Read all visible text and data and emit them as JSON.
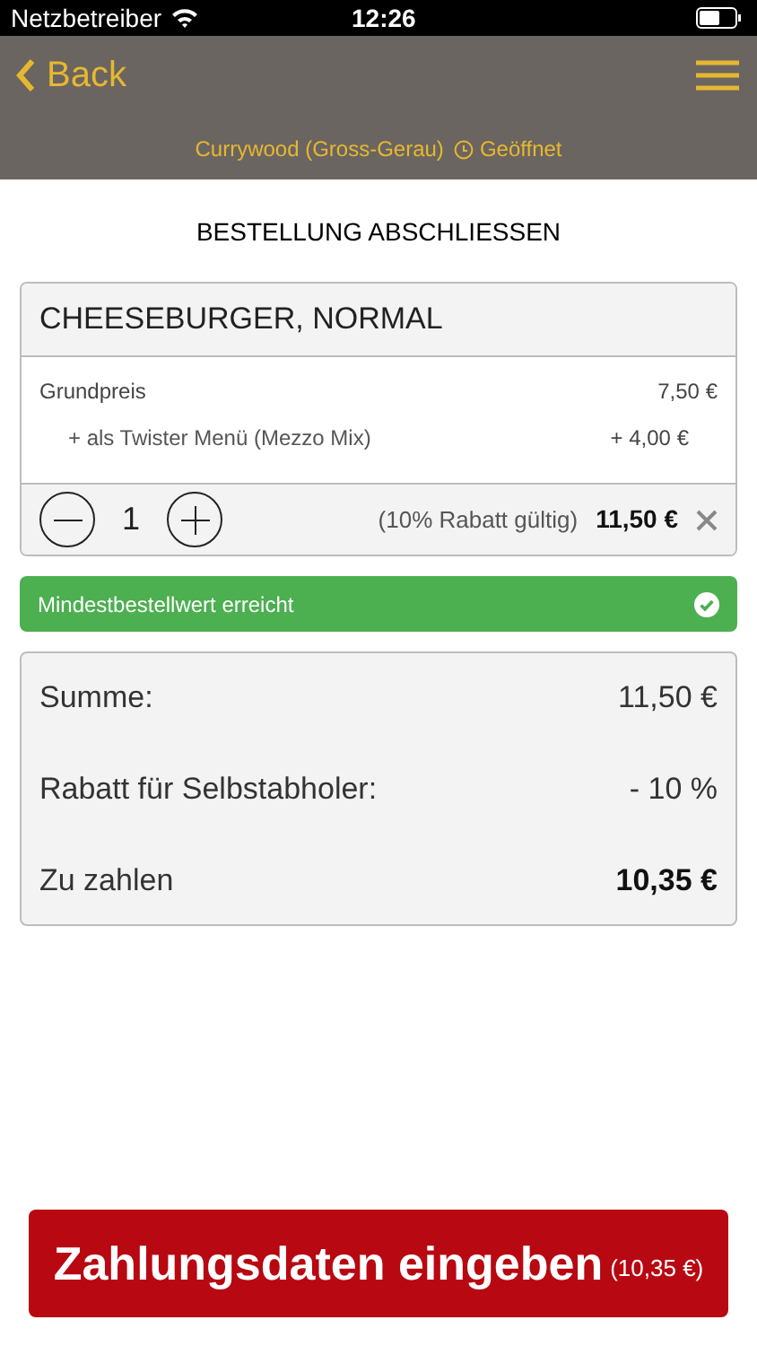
{
  "status_bar": {
    "carrier": "Netzbetreiber",
    "time": "12:26"
  },
  "nav": {
    "back": "Back",
    "restaurant": "Currywood (Gross-Gerau)",
    "status": "Geöffnet"
  },
  "title": "BESTELLUNG ABSCHLIESSEN",
  "item": {
    "name": "CHEESEBURGER, NORMAL",
    "lines": [
      {
        "label": "Grundpreis",
        "price": "7,50 €",
        "indented": false
      },
      {
        "label": "+ als Twister Menü (Mezzo Mix)",
        "price": "+ 4,00 €",
        "indented": true
      }
    ],
    "quantity": "1",
    "discount_note": "(10% Rabatt gültig)",
    "total": "11,50 €"
  },
  "notice": {
    "text": "Mindestbestellwert erreicht",
    "reached": true
  },
  "summary": [
    {
      "label": "Summe:",
      "value": "11,50 €",
      "emphasis": false
    },
    {
      "label": "Rabatt für Selbstabholer:",
      "value": "- 10 %",
      "emphasis": false
    },
    {
      "label": "Zu zahlen",
      "value": "10,35 €",
      "emphasis": true
    }
  ],
  "pay_button": {
    "label": "Zahlungsdaten eingeben",
    "amount": "(10,35 €)"
  }
}
